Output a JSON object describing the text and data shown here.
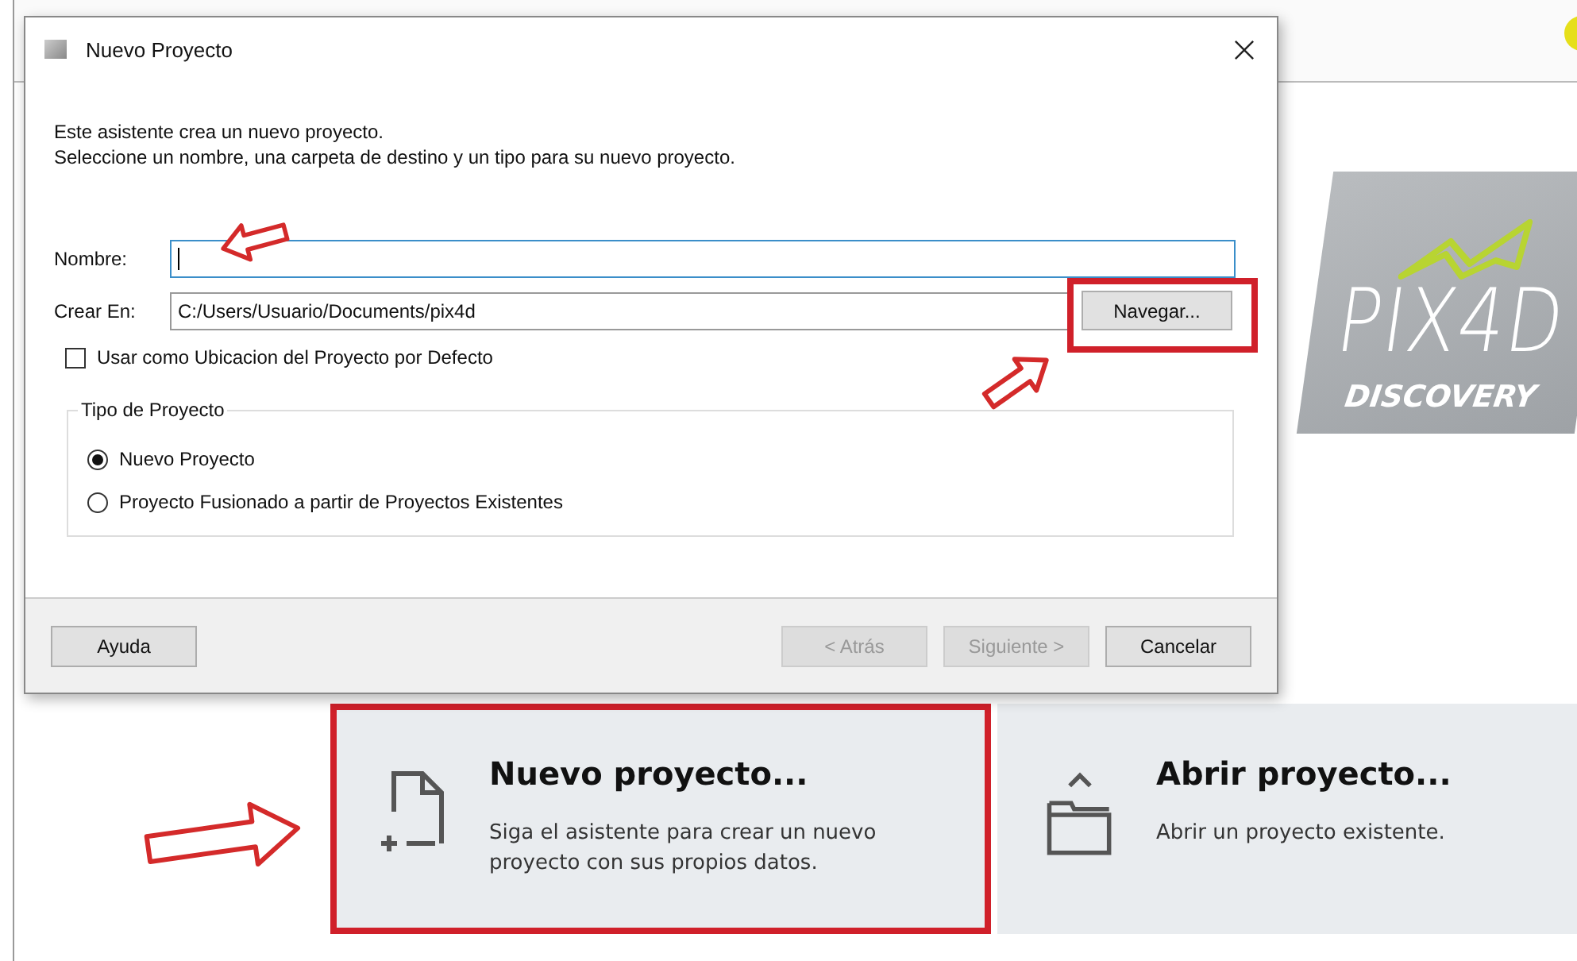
{
  "dialog": {
    "title": "Nuevo Proyecto",
    "intro": [
      "Este asistente crea un nuevo proyecto.",
      "Seleccione un nombre, una carpeta de destino y un tipo para su nuevo proyecto."
    ],
    "name_field": {
      "label": "Nombre:",
      "focused": true
    },
    "location_field": {
      "label": "Crear En:",
      "value": "C:/Users/Usuario/Documents/pix4d",
      "button": "Navegar..."
    },
    "default_checkbox": {
      "label": "Usar como Ubicacion del Proyecto por Defecto",
      "checked": false
    },
    "project_type": {
      "title": "Tipo de Proyecto",
      "options": [
        {
          "label": "Nuevo Proyecto",
          "selected": true
        },
        {
          "label": "Proyecto Fusionado a partir de Proyectos Existentes",
          "selected": false
        }
      ]
    },
    "buttons": [
      {
        "kind": "help",
        "label": "Ayuda",
        "disabled": false
      },
      {
        "kind": "wizard",
        "label": "< Atrás",
        "disabled": true
      },
      {
        "kind": "wizard",
        "label": "Siguiente >",
        "disabled": true
      },
      {
        "kind": "wizard",
        "label": "Cancelar",
        "disabled": false
      }
    ]
  },
  "logo": {
    "name": "PIX4D",
    "subtitle": "DISCOVERY"
  },
  "cards": [
    {
      "kind": "new",
      "title": "Nuevo proyecto...",
      "description": "Siga el asistente para crear un nuevo proyecto con sus propios datos.",
      "highlighted": true
    },
    {
      "kind": "open",
      "title": "Abrir proyecto...",
      "description": "Abrir un proyecto existente.",
      "highlighted": false
    }
  ]
}
